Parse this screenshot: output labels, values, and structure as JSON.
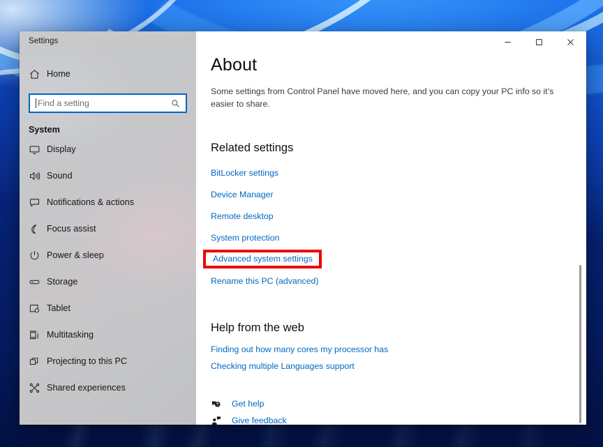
{
  "window": {
    "title": "Settings",
    "controls": {
      "minimize": "—",
      "maximize": "☐",
      "close": "×",
      "minimize_name": "Minimize",
      "maximize_name": "Maximize",
      "close_name": "Close"
    }
  },
  "sidebar": {
    "home_label": "Home",
    "home_icon": "home-icon",
    "search": {
      "placeholder": "Find a setting",
      "value": "",
      "icon": "search-icon"
    },
    "section_label": "System",
    "items": [
      {
        "label": "Display",
        "icon": "monitor-icon"
      },
      {
        "label": "Sound",
        "icon": "speaker-icon"
      },
      {
        "label": "Notifications & actions",
        "icon": "notification-icon"
      },
      {
        "label": "Focus assist",
        "icon": "moon-icon"
      },
      {
        "label": "Power & sleep",
        "icon": "power-icon"
      },
      {
        "label": "Storage",
        "icon": "storage-icon"
      },
      {
        "label": "Tablet",
        "icon": "tablet-icon"
      },
      {
        "label": "Multitasking",
        "icon": "multitasking-icon"
      },
      {
        "label": "Projecting to this PC",
        "icon": "projecting-icon"
      },
      {
        "label": "Shared experiences",
        "icon": "shared-experiences-icon"
      }
    ]
  },
  "main": {
    "title": "About",
    "description": "Some settings from Control Panel have moved here, and you can copy your PC info so it’s easier to share.",
    "related": {
      "heading": "Related settings",
      "links": [
        {
          "label": "BitLocker settings",
          "highlighted": false
        },
        {
          "label": "Device Manager",
          "highlighted": false
        },
        {
          "label": "Remote desktop",
          "highlighted": false
        },
        {
          "label": "System protection",
          "highlighted": false
        },
        {
          "label": "Advanced system settings",
          "highlighted": true
        },
        {
          "label": "Rename this PC (advanced)",
          "highlighted": false
        }
      ]
    },
    "help": {
      "heading": "Help from the web",
      "links": [
        "Finding out how many cores my processor has",
        "Checking multiple Languages support"
      ]
    },
    "support": [
      {
        "label": "Get help",
        "icon": "get-help-icon"
      },
      {
        "label": "Give feedback",
        "icon": "give-feedback-icon"
      }
    ]
  },
  "colors": {
    "accent_link": "#0067c0",
    "highlight_box": "#ee0000",
    "focus_border": "#0067c0",
    "sidebar_bg": "#c7c8ca"
  }
}
